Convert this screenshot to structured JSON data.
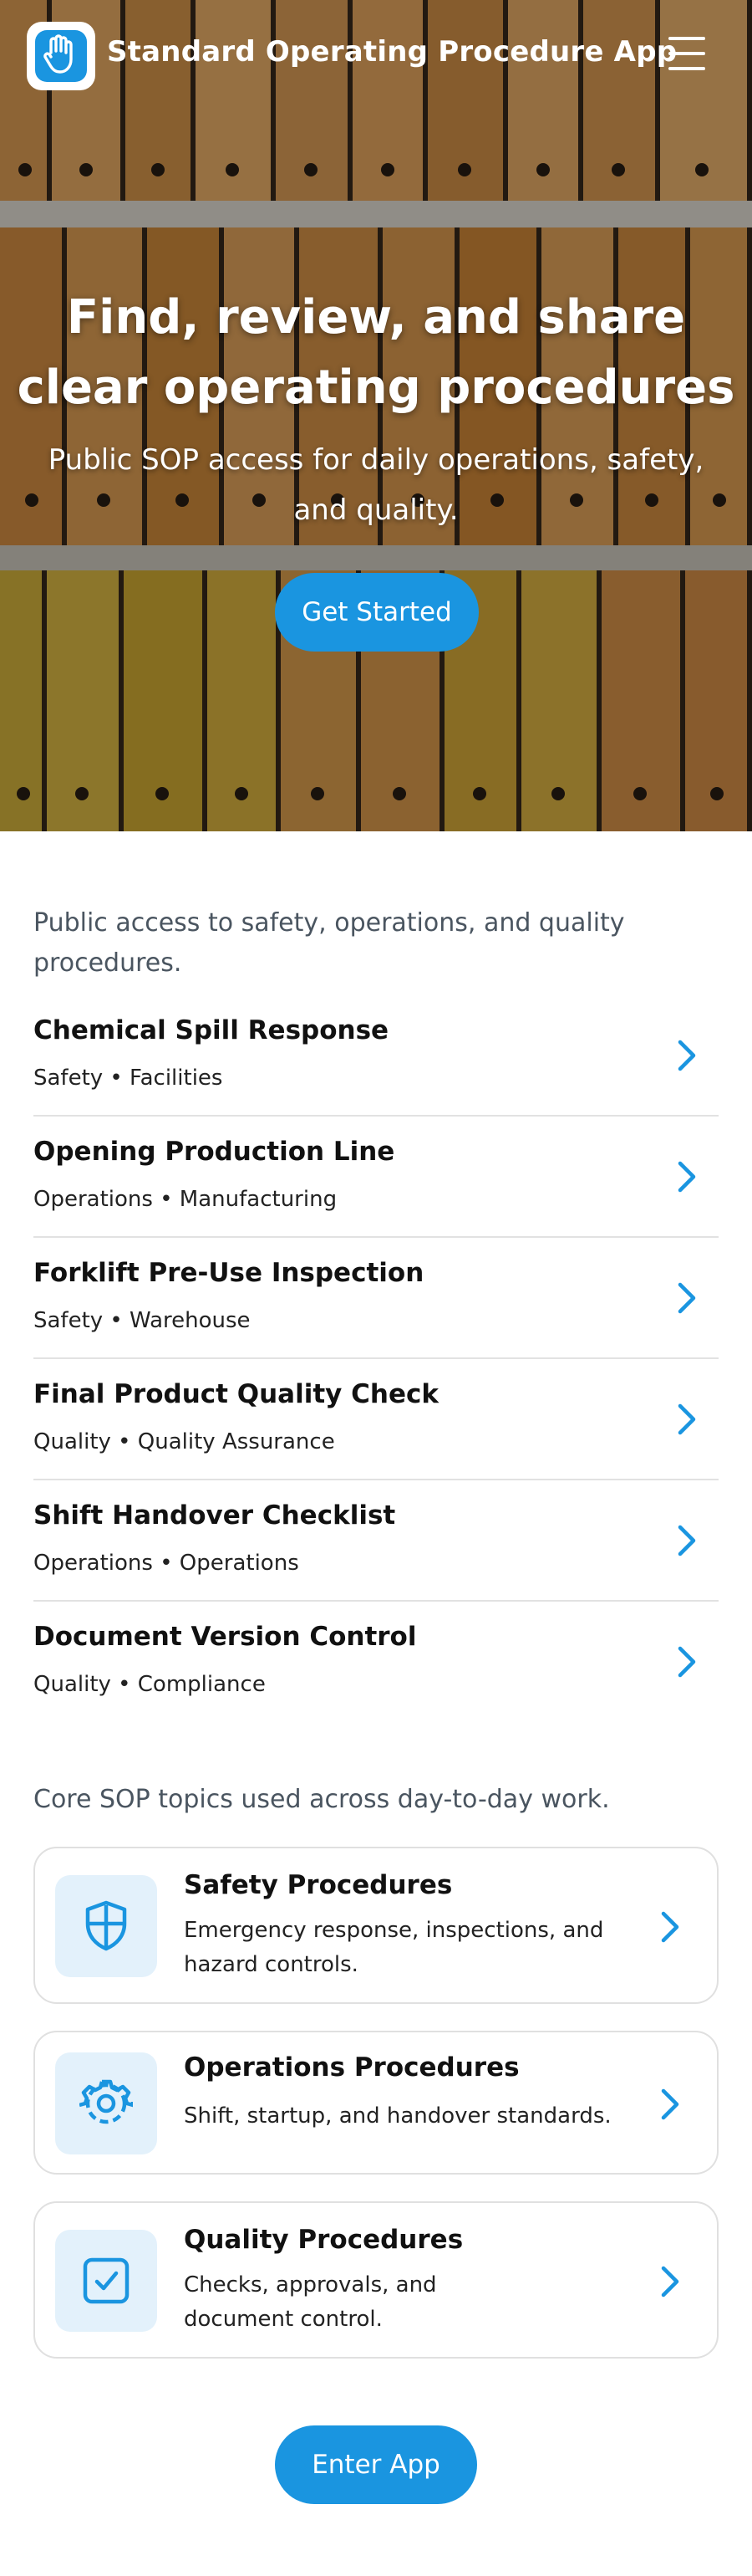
{
  "app": {
    "title": "Standard Operating Procedure App",
    "logo_icon": "raised-hand-icon",
    "menu_icon": "hamburger-menu-icon",
    "accent_color": "#1a95e0"
  },
  "hero": {
    "title": "Find, review, and share clear operating procedures",
    "subtitle": "Public SOP access for daily operations, safety, and quality.",
    "cta_label": "Get Started"
  },
  "sops": {
    "intro": "Public access to safety, operations, and quality procedures.",
    "items": [
      {
        "title": "Chemical Spill Response",
        "meta": "Safety • Facilities"
      },
      {
        "title": "Opening Production Line",
        "meta": "Operations • Manufacturing"
      },
      {
        "title": "Forklift Pre-Use Inspection",
        "meta": "Safety • Warehouse"
      },
      {
        "title": "Final Product Quality Check",
        "meta": "Quality • Quality Assurance"
      },
      {
        "title": "Shift Handover Checklist",
        "meta": "Operations • Operations"
      },
      {
        "title": "Document Version Control",
        "meta": "Quality • Compliance"
      }
    ]
  },
  "topics": {
    "intro": "Core SOP topics used across day-to-day work.",
    "items": [
      {
        "title": "Safety Procedures",
        "desc": "Emergency response, inspections, and hazard controls.",
        "icon": "shield-icon"
      },
      {
        "title": "Operations Procedures",
        "desc": "Shift, startup, and handover standards.",
        "icon": "gear-icon"
      },
      {
        "title": "Quality Procedures",
        "desc": "Checks, approvals, and document control.",
        "icon": "checkbox-icon"
      }
    ]
  },
  "footer": {
    "cta_label": "Enter App"
  }
}
